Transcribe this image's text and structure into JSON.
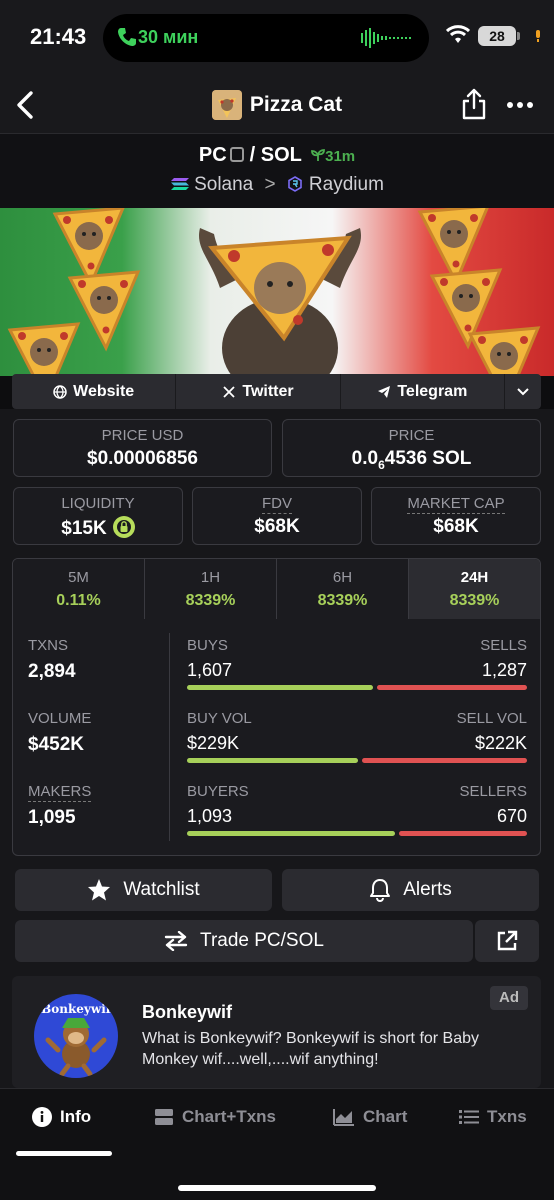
{
  "status": {
    "time": "21:43",
    "call": "30 мин",
    "battery": "28"
  },
  "nav": {
    "title": "Pizza Cat"
  },
  "pair": {
    "base": "PC",
    "sep": "/",
    "quote": "SOL",
    "age": "31m",
    "chain": "Solana",
    "dex": "Raydium"
  },
  "links": {
    "website": "Website",
    "twitter": "Twitter",
    "telegram": "Telegram"
  },
  "price": {
    "usd_label": "PRICE USD",
    "usd_value": "$0.00006856",
    "sol_label": "PRICE",
    "sol_prefix": "0.0",
    "sol_sub": "6",
    "sol_rest": "4536 SOL"
  },
  "metrics": {
    "liquidity_label": "LIQUIDITY",
    "liquidity_value": "$15K",
    "fdv_label": "FDV",
    "fdv_value": "$68K",
    "mcap_label": "MARKET CAP",
    "mcap_value": "$68K"
  },
  "timeframes": [
    {
      "key": "5M",
      "value": "0.11%"
    },
    {
      "key": "1H",
      "value": "8339%"
    },
    {
      "key": "6H",
      "value": "8339%"
    },
    {
      "key": "24H",
      "value": "8339%"
    }
  ],
  "stats": {
    "txns_label": "TXNS",
    "txns_value": "2,894",
    "volume_label": "VOLUME",
    "volume_value": "$452K",
    "makers_label": "MAKERS",
    "makers_value": "1,095",
    "buys_label": "BUYS",
    "buys_value": "1,607",
    "sells_label": "SELLS",
    "sells_value": "1,287",
    "buyvol_label": "BUY VOL",
    "buyvol_value": "$229K",
    "sellvol_label": "SELL VOL",
    "sellvol_value": "$222K",
    "buyers_label": "BUYERS",
    "buyers_value": "1,093",
    "sellers_label": "SELLERS",
    "sellers_value": "670",
    "buys_ratio": 0.555,
    "buyvol_ratio": 0.508,
    "buyers_ratio": 0.62
  },
  "actions": {
    "watchlist": "Watchlist",
    "alerts": "Alerts",
    "trade": "Trade PC/SOL"
  },
  "ad": {
    "tag": "Ad",
    "logo_text": "Bonkeywif",
    "title": "Bonkeywif",
    "description": "What is Bonkeywif? Bonkeywif is short for Baby Monkey wif....well,....wif anything!"
  },
  "tabs": {
    "info": "Info",
    "chart_txns": "Chart+Txns",
    "chart": "Chart",
    "txns": "Txns"
  },
  "colors": {
    "buy": "#a7d05a",
    "sell": "#e05252",
    "accent_green": "#3ed15c",
    "ad_logo": "#2f49d6"
  }
}
